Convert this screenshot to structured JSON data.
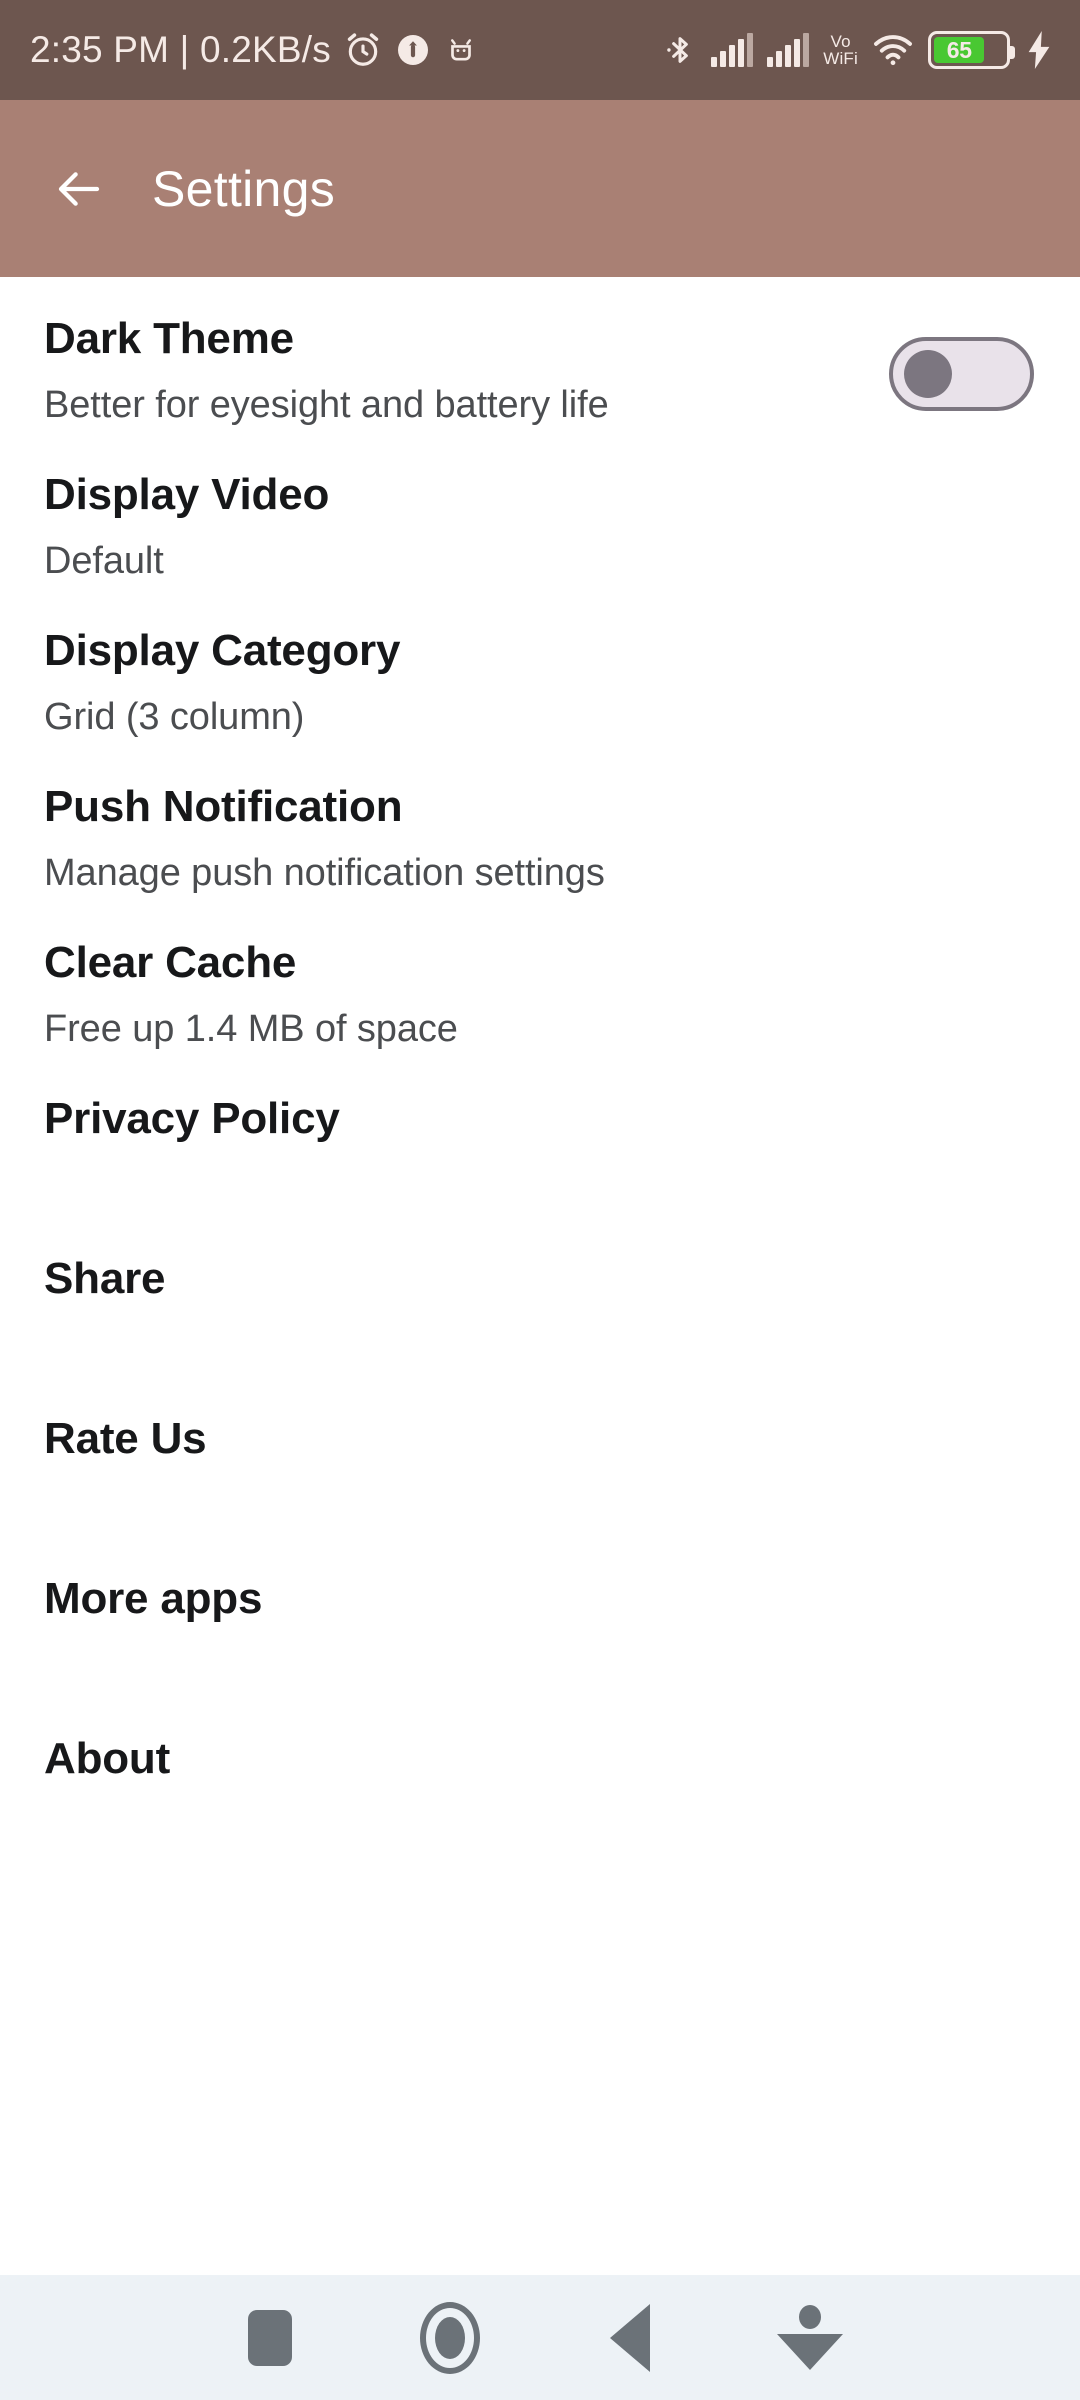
{
  "status_bar": {
    "clock": "2:35 PM | 0.2KB/s",
    "icons": [
      "alarm-icon",
      "do-not-disturb-icon",
      "android-debug-icon",
      "bluetooth-icon",
      "signal-icon",
      "signal-icon",
      "vowifi-icon",
      "wifi-icon",
      "battery-icon",
      "charging-bolt-icon"
    ],
    "vowifi_line1": "Vo",
    "vowifi_line2": "WiFi",
    "battery_level": "65",
    "battery_color": "#49C832",
    "background": "#6D564F",
    "text_color": "#F5EAE6"
  },
  "app_bar": {
    "title": "Settings",
    "back_icon": "arrow-left-icon",
    "background": "#A98074",
    "title_color": "#FFFFFF"
  },
  "settings": {
    "items": [
      {
        "title": "Dark Theme",
        "subtitle": "Better for eyesight and battery life",
        "control": "switch",
        "switch_on": false
      },
      {
        "title": "Display Video",
        "subtitle": "Default",
        "control": "none"
      },
      {
        "title": "Display Category",
        "subtitle": "Grid (3 column)",
        "control": "none"
      },
      {
        "title": "Push Notification",
        "subtitle": "Manage push notification settings",
        "control": "none"
      },
      {
        "title": "Clear Cache",
        "subtitle": "Free up 1.4 MB of space",
        "control": "none"
      },
      {
        "title": "Privacy Policy",
        "subtitle": "",
        "control": "none"
      },
      {
        "title": "Share",
        "subtitle": "",
        "control": "none"
      },
      {
        "title": "Rate Us",
        "subtitle": "",
        "control": "none"
      },
      {
        "title": "More apps",
        "subtitle": "",
        "control": "none"
      },
      {
        "title": "About",
        "subtitle": "",
        "control": "none"
      }
    ],
    "title_color": "#17181A",
    "subtitle_color": "#4B4D50"
  },
  "nav_bar": {
    "buttons": [
      "recents-square-icon",
      "home-circle-icon",
      "back-triangle-icon",
      "hide-keyboard-icon"
    ],
    "background": "#EDF2F6",
    "icon_color": "#6B7278"
  }
}
